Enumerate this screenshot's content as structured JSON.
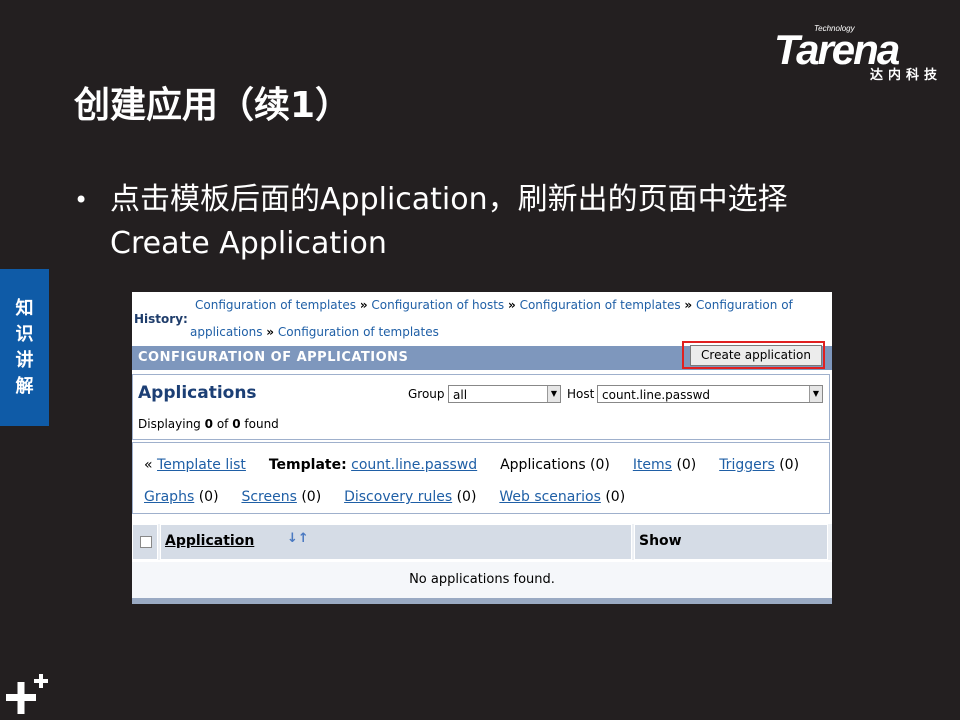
{
  "logo": {
    "tagline": "Technology",
    "brand": "Tarena",
    "cn": "达内科技"
  },
  "slide": {
    "title": "创建应用（续1）",
    "bullet": "点击模板后面的Application，刷新出的页面中选择Create Application",
    "side_tab": [
      "知",
      "识",
      "讲",
      "解"
    ]
  },
  "screenshot": {
    "history_label": "History:",
    "breadcrumb_line1": [
      "Configuration of templates",
      "Configuration of hosts",
      "Configuration of templates",
      "Configuration of"
    ],
    "breadcrumb_line2": [
      "applications",
      "Configuration of templates"
    ],
    "separator": "»",
    "header_title": "CONFIGURATION OF APPLICATIONS",
    "create_button": "Create application",
    "panel_title": "Applications",
    "group_label": "Group",
    "group_value": "all",
    "host_label": "Host",
    "host_value": "count.line.passwd",
    "displaying": {
      "prefix": "Displaying",
      "from": "0",
      "of_word": "of",
      "total": "0",
      "suffix": "found"
    },
    "template_row": {
      "back_prefix": "«",
      "template_list": "Template list",
      "template_label": "Template:",
      "template_name": "count.line.passwd",
      "applications": "Applications (0)",
      "items": "Items",
      "items_count": "(0)",
      "triggers": "Triggers",
      "triggers_count": "(0)",
      "graphs": "Graphs",
      "graphs_count": "(0)",
      "screens": "Screens",
      "screens_count": "(0)",
      "discovery": "Discovery rules",
      "discovery_count": "(0)",
      "web": "Web scenarios",
      "web_count": "(0)"
    },
    "columns": [
      "Application",
      "Show"
    ],
    "empty_message": "No applications found."
  },
  "colors": {
    "background": "#231f20",
    "side_tab": "#0f5ba7",
    "header_bar": "#7e97bd",
    "highlight": "#e02020"
  }
}
